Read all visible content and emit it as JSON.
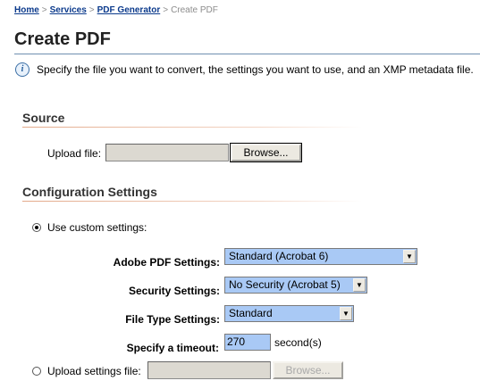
{
  "breadcrumb": {
    "links": [
      "Home",
      "Services",
      "PDF Generator"
    ],
    "current": "Create PDF",
    "separator": ">"
  },
  "page": {
    "title": "Create PDF",
    "info_text": "Specify the file you want to convert, the settings you want to use, and an XMP metadata file."
  },
  "source": {
    "section_title": "Source",
    "upload_label": "Upload file:",
    "upload_value": "",
    "browse_label": "Browse..."
  },
  "config": {
    "section_title": "Configuration Settings",
    "custom_label": "Use custom settings:",
    "custom_selected": true,
    "adobe_label": "Adobe PDF Settings:",
    "adobe_value": "Standard (Acrobat 6)",
    "security_label": "Security Settings:",
    "security_value": "No Security (Acrobat 5)",
    "filetype_label": "File Type Settings:",
    "filetype_value": "Standard",
    "timeout_label": "Specify a timeout:",
    "timeout_value": "270",
    "timeout_unit": "second(s)",
    "upload_settings_label": "Upload settings file:",
    "upload_settings_value": "",
    "upload_settings_selected": false,
    "browse_disabled_label": "Browse..."
  },
  "colors": {
    "link": "#0b3a8c",
    "select_bg": "#a9c9f5",
    "section_rule": "#e3a98a",
    "title_rule": "#6f8fb0"
  }
}
